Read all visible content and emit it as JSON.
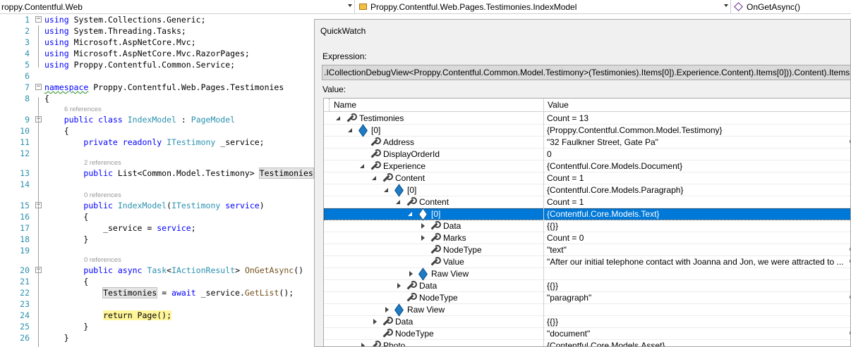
{
  "navbar": {
    "project": "roppy.Contentful.Web",
    "class": "Proppy.Contentful.Web.Pages.Testimonies.IndexModel",
    "member": "OnGetAsync()"
  },
  "editor": {
    "lines": [
      {
        "n": "1",
        "fold": "−",
        "ref": "",
        "parts": [
          [
            "kw",
            "using"
          ],
          [
            "",
            "System.Collections.Generic;"
          ]
        ]
      },
      {
        "n": "2",
        "fold": "",
        "ref": "",
        "parts": [
          [
            "kw",
            "using"
          ],
          [
            "",
            "System.Threading.Tasks;"
          ]
        ]
      },
      {
        "n": "3",
        "fold": "",
        "ref": "",
        "parts": [
          [
            "kw",
            "using"
          ],
          [
            "",
            "Microsoft.AspNetCore.Mvc;"
          ]
        ]
      },
      {
        "n": "4",
        "fold": "",
        "ref": "",
        "parts": [
          [
            "kw",
            "using"
          ],
          [
            "",
            "Microsoft.AspNetCore.Mvc.RazorPages;"
          ]
        ]
      },
      {
        "n": "5",
        "fold": "",
        "ref": "",
        "parts": [
          [
            "kw",
            "using"
          ],
          [
            "",
            "Proppy.Contentful.Common.Service;"
          ]
        ]
      },
      {
        "n": "6",
        "fold": "",
        "ref": "",
        "parts": []
      },
      {
        "n": "7",
        "fold": "−",
        "ref": "",
        "parts": [
          [
            "kw-squig",
            "namespace"
          ],
          [
            "",
            "Proppy.Contentful.Web.Pages.Testimonies"
          ]
        ]
      },
      {
        "n": "8",
        "fold": "",
        "ref": "",
        "parts": [
          [
            "",
            "{"
          ]
        ]
      },
      {
        "n": "9",
        "fold": "−",
        "ref": "6 references",
        "parts": [
          [
            "",
            "    "
          ],
          [
            "kw",
            "public class"
          ],
          [
            "",
            ""
          ],
          [
            "ty",
            "IndexModel"
          ],
          [
            "",
            " : "
          ],
          [
            "ty",
            "PageModel"
          ]
        ]
      },
      {
        "n": "10",
        "fold": "",
        "ref": "",
        "parts": [
          [
            "",
            "    {"
          ]
        ]
      },
      {
        "n": "11",
        "fold": "",
        "ref": "",
        "parts": [
          [
            "",
            "        "
          ],
          [
            "kw",
            "private readonly"
          ],
          [
            "",
            ""
          ],
          [
            "ty",
            "ITestimony"
          ],
          [
            "",
            " _service;"
          ]
        ]
      },
      {
        "n": "12",
        "fold": "",
        "ref": "",
        "parts": []
      },
      {
        "n": "13",
        "fold": "",
        "ref": "2 references",
        "parts": [
          [
            "",
            "        "
          ],
          [
            "kw",
            "public"
          ],
          [
            "",
            " List<Common.Model.Testimony> "
          ],
          [
            "box",
            "Testimonies"
          ]
        ]
      },
      {
        "n": "14",
        "fold": "",
        "ref": "",
        "parts": []
      },
      {
        "n": "15",
        "fold": "−",
        "ref": "0 references",
        "parts": [
          [
            "",
            "        "
          ],
          [
            "kw",
            "public"
          ],
          [
            "",
            ""
          ],
          [
            "ty",
            "IndexModel"
          ],
          [
            "",
            "("
          ],
          [
            "ty",
            "ITestimony"
          ],
          [
            "",
            " "
          ],
          [
            "kw",
            "service"
          ],
          [
            "",
            ")"
          ]
        ]
      },
      {
        "n": "16",
        "fold": "",
        "ref": "",
        "parts": [
          [
            "",
            "        {"
          ]
        ]
      },
      {
        "n": "17",
        "fold": "",
        "ref": "",
        "parts": [
          [
            "",
            "            _service = "
          ],
          [
            "kw",
            "service"
          ],
          [
            "",
            ";"
          ]
        ]
      },
      {
        "n": "18",
        "fold": "",
        "ref": "",
        "parts": [
          [
            "",
            "        }"
          ]
        ]
      },
      {
        "n": "19",
        "fold": "",
        "ref": "",
        "parts": []
      },
      {
        "n": "20",
        "fold": "−",
        "ref": "0 references",
        "parts": [
          [
            "",
            "        "
          ],
          [
            "kw",
            "public async"
          ],
          [
            "",
            " "
          ],
          [
            "ty",
            "Task"
          ],
          [
            "",
            "<"
          ],
          [
            "ty",
            "IActionResult"
          ],
          [
            "",
            "> "
          ],
          [
            "me",
            "OnGetAsync"
          ],
          [
            "",
            "()"
          ]
        ]
      },
      {
        "n": "21",
        "fold": "",
        "ref": "",
        "parts": [
          [
            "",
            "        {"
          ]
        ]
      },
      {
        "n": "22",
        "fold": "",
        "ref": "",
        "parts": [
          [
            "",
            "            "
          ],
          [
            "box",
            "Testimonies"
          ],
          [
            "",
            " = "
          ],
          [
            "kw",
            "await"
          ],
          [
            "",
            " _service."
          ],
          [
            "me",
            "GetList"
          ],
          [
            "",
            "();"
          ]
        ]
      },
      {
        "n": "23",
        "fold": "",
        "ref": "",
        "parts": []
      },
      {
        "n": "24",
        "fold": "",
        "ref": "",
        "parts": [
          [
            "",
            "            "
          ],
          [
            "yellow",
            "return Page();"
          ]
        ]
      },
      {
        "n": "25",
        "fold": "",
        "ref": "",
        "parts": [
          [
            "",
            "        }"
          ]
        ]
      },
      {
        "n": "26",
        "fold": "",
        "ref": "",
        "parts": [
          [
            "",
            "    }"
          ]
        ]
      }
    ]
  },
  "quickwatch": {
    "title": "QuickWatch",
    "expression_label": "Expression:",
    "expression": ".ICollectionDebugView<Proppy.Contentful.Common.Model.Testimony>(Testimonies).Items[0]).Experience.Content).Items[0])).Content).Items",
    "value_label": "Value:",
    "col_name": "Name",
    "col_value": "Value",
    "rows": [
      {
        "indent": 0,
        "exp": "open",
        "icon": "wrench",
        "name": "Testimonies",
        "value": "Count = 13",
        "mag": false,
        "sel": false
      },
      {
        "indent": 1,
        "exp": "open",
        "icon": "cube",
        "name": "[0]",
        "value": "{Proppy.Contentful.Common.Model.Testimony}",
        "mag": false,
        "sel": false
      },
      {
        "indent": 2,
        "exp": "",
        "icon": "wrench",
        "name": "Address",
        "value": "\"32 Faulkner Street, Gate Pa\"",
        "mag": true,
        "sel": false
      },
      {
        "indent": 2,
        "exp": "",
        "icon": "wrench",
        "name": "DisplayOrderId",
        "value": "0",
        "mag": false,
        "sel": false
      },
      {
        "indent": 2,
        "exp": "open",
        "icon": "wrench",
        "name": "Experience",
        "value": "{Contentful.Core.Models.Document}",
        "mag": false,
        "sel": false
      },
      {
        "indent": 3,
        "exp": "open",
        "icon": "wrench",
        "name": "Content",
        "value": "Count = 1",
        "mag": false,
        "sel": false
      },
      {
        "indent": 4,
        "exp": "open",
        "icon": "cube",
        "name": "[0]",
        "value": "{Contentful.Core.Models.Paragraph}",
        "mag": false,
        "sel": false
      },
      {
        "indent": 5,
        "exp": "open",
        "icon": "wrench",
        "name": "Content",
        "value": "Count = 1",
        "mag": false,
        "sel": false
      },
      {
        "indent": 6,
        "exp": "open",
        "icon": "cube",
        "name": "[0]",
        "value": "{Contentful.Core.Models.Text}",
        "mag": false,
        "sel": true
      },
      {
        "indent": 7,
        "exp": "closed",
        "icon": "wrench",
        "name": "Data",
        "value": "{{}}",
        "mag": false,
        "sel": false
      },
      {
        "indent": 7,
        "exp": "closed",
        "icon": "wrench",
        "name": "Marks",
        "value": "Count = 0",
        "mag": false,
        "sel": false
      },
      {
        "indent": 7,
        "exp": "",
        "icon": "wrench",
        "name": "NodeType",
        "value": "\"text\"",
        "mag": true,
        "sel": false
      },
      {
        "indent": 7,
        "exp": "",
        "icon": "wrench",
        "name": "Value",
        "value": "\"After our initial telephone contact with Joanna and Jon, we were attracted to ...",
        "mag": true,
        "sel": false
      },
      {
        "indent": 6,
        "exp": "closed",
        "icon": "cube",
        "name": "Raw View",
        "value": "",
        "mag": false,
        "sel": false
      },
      {
        "indent": 5,
        "exp": "closed",
        "icon": "wrench",
        "name": "Data",
        "value": "{{}}",
        "mag": false,
        "sel": false
      },
      {
        "indent": 5,
        "exp": "",
        "icon": "wrench",
        "name": "NodeType",
        "value": "\"paragraph\"",
        "mag": true,
        "sel": false
      },
      {
        "indent": 4,
        "exp": "closed",
        "icon": "cube",
        "name": "Raw View",
        "value": "",
        "mag": false,
        "sel": false
      },
      {
        "indent": 3,
        "exp": "closed",
        "icon": "wrench",
        "name": "Data",
        "value": "{{}}",
        "mag": false,
        "sel": false
      },
      {
        "indent": 3,
        "exp": "",
        "icon": "wrench",
        "name": "NodeType",
        "value": "\"document\"",
        "mag": true,
        "sel": false
      },
      {
        "indent": 2,
        "exp": "closed",
        "icon": "wrench",
        "name": "Photo",
        "value": "{Contentful.Core.Models.Asset}",
        "mag": false,
        "sel": false
      }
    ]
  }
}
